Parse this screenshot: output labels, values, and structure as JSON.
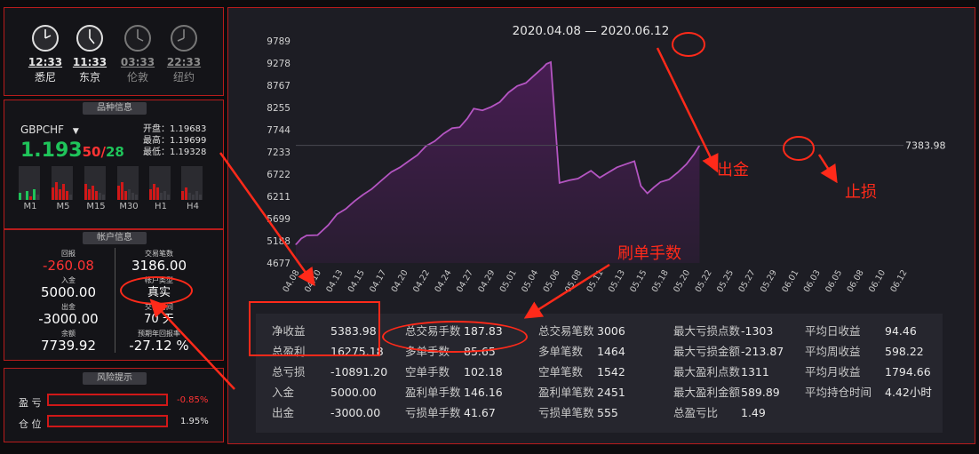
{
  "clocks": [
    {
      "time": "12:33",
      "city": "悉尼",
      "active": true
    },
    {
      "time": "11:33",
      "city": "东京",
      "active": true
    },
    {
      "time": "03:33",
      "city": "伦敦",
      "active": false
    },
    {
      "time": "22:33",
      "city": "纽约",
      "active": false
    }
  ],
  "symbol": {
    "section_title": "品种信息",
    "name": "GBPCHF",
    "price_main": "1.193",
    "price_frac": "50",
    "price_sep": "/",
    "spread": "28",
    "open": "开盘：1.19683",
    "high": "最高：1.19699",
    "low": "最低：1.19328",
    "timeframes": [
      "M1",
      "M5",
      "M15",
      "M30",
      "H1",
      "H4"
    ]
  },
  "account": {
    "section_title": "帐户信息",
    "drawdown_label": "回报",
    "drawdown_value": "-260.08",
    "trades_label": "交易笔数",
    "trades_value": "3186.00",
    "deposit_label": "入金",
    "deposit_value": "5000.00",
    "type_label": "帐户类型",
    "type_value": "真实",
    "withdraw_label": "出金",
    "withdraw_value": "-3000.00",
    "days_label": "交易时间",
    "days_value": "70 天",
    "balance_label": "余额",
    "balance_value": "7739.92",
    "annual_label": "预期年回报率",
    "annual_value": "-27.12 %"
  },
  "risk": {
    "section_title": "风险提示",
    "profit_label": "盈 亏",
    "profit_value": "-0.85%",
    "position_label": "仓 位",
    "position_value": "1.95%"
  },
  "chart_data": {
    "type": "area",
    "title": "2020.04.08 — 2020.06.12",
    "last_value_label": "7383.98",
    "ylim": [
      4677,
      9789
    ],
    "yticks": [
      4677,
      5188,
      5699,
      6211,
      6722,
      7233,
      7744,
      8255,
      8767,
      9278,
      9789
    ],
    "xticks": [
      "04.08",
      "04.10",
      "04.13",
      "04.15",
      "04.17",
      "04.20",
      "04.22",
      "04.24",
      "04.27",
      "04.29",
      "05.01",
      "05.04",
      "05.06",
      "05.08",
      "05.11",
      "05.13",
      "05.15",
      "05.18",
      "05.20",
      "05.22",
      "05.25",
      "05.27",
      "05.29",
      "06.01",
      "06.03",
      "06.05",
      "06.08",
      "06.10",
      "06.12"
    ],
    "points": [
      [
        0,
        5100
      ],
      [
        0.25,
        5240
      ],
      [
        0.5,
        5310
      ],
      [
        1.0,
        5320
      ],
      [
        1.5,
        5550
      ],
      [
        1.9,
        5800
      ],
      [
        2.3,
        5920
      ],
      [
        2.7,
        6100
      ],
      [
        3.1,
        6250
      ],
      [
        3.5,
        6380
      ],
      [
        4.0,
        6600
      ],
      [
        4.4,
        6770
      ],
      [
        4.8,
        6880
      ],
      [
        5.2,
        7020
      ],
      [
        5.6,
        7160
      ],
      [
        6.0,
        7370
      ],
      [
        6.4,
        7480
      ],
      [
        6.8,
        7650
      ],
      [
        7.2,
        7780
      ],
      [
        7.55,
        7800
      ],
      [
        7.9,
        8000
      ],
      [
        8.2,
        8230
      ],
      [
        8.6,
        8190
      ],
      [
        9.0,
        8270
      ],
      [
        9.4,
        8380
      ],
      [
        9.8,
        8600
      ],
      [
        10.2,
        8750
      ],
      [
        10.6,
        8820
      ],
      [
        11.0,
        9000
      ],
      [
        11.4,
        9180
      ],
      [
        11.55,
        9260
      ],
      [
        11.75,
        9300
      ],
      [
        12.15,
        6520
      ],
      [
        12.6,
        6580
      ],
      [
        13.0,
        6620
      ],
      [
        13.3,
        6710
      ],
      [
        13.6,
        6800
      ],
      [
        14.0,
        6640
      ],
      [
        14.4,
        6760
      ],
      [
        14.8,
        6880
      ],
      [
        15.2,
        6950
      ],
      [
        15.6,
        7020
      ],
      [
        15.9,
        6450
      ],
      [
        16.2,
        6280
      ],
      [
        16.5,
        6420
      ],
      [
        16.8,
        6540
      ],
      [
        17.2,
        6600
      ],
      [
        17.6,
        6760
      ],
      [
        18.0,
        6950
      ],
      [
        18.35,
        7180
      ],
      [
        18.6,
        7383.98
      ]
    ],
    "line_color": "#b455c2",
    "fill_color": "#4a1d55"
  },
  "stats": {
    "col1": [
      {
        "label": "净收益",
        "value": "5383.98"
      },
      {
        "label": "总盈利",
        "value": "16275.18"
      },
      {
        "label": "总亏损",
        "value": "-10891.20"
      },
      {
        "label": "入金",
        "value": "5000.00"
      },
      {
        "label": "出金",
        "value": "-3000.00"
      }
    ],
    "col2": [
      {
        "label": "总交易手数",
        "value": "187.83"
      },
      {
        "label": "多单手数",
        "value": "85.65"
      },
      {
        "label": "空单手数",
        "value": "102.18"
      },
      {
        "label": "盈利单手数",
        "value": "146.16"
      },
      {
        "label": "亏损单手数",
        "value": "41.67"
      }
    ],
    "col3": [
      {
        "label": "总交易笔数",
        "value": "3006"
      },
      {
        "label": "多单笔数",
        "value": "1464"
      },
      {
        "label": "空单笔数",
        "value": "1542"
      },
      {
        "label": "盈利单笔数",
        "value": "2451"
      },
      {
        "label": "亏损单笔数",
        "value": "555"
      }
    ],
    "col4": [
      {
        "label": "最大亏损点数",
        "value": "-1303"
      },
      {
        "label": "最大亏损金额",
        "value": "-213.87"
      },
      {
        "label": "最大盈利点数",
        "value": "1311"
      },
      {
        "label": "最大盈利金额",
        "value": "589.89"
      },
      {
        "label": "总盈亏比",
        "value": "1.49"
      }
    ],
    "col5": [
      {
        "label": "平均日收益",
        "value": "94.46"
      },
      {
        "label": "平均周收益",
        "value": "598.22"
      },
      {
        "label": "平均月收益",
        "value": "1794.66"
      },
      {
        "label": "平均持仓时间",
        "value": "4.42小时"
      }
    ]
  },
  "annotations": {
    "withdraw": "出金",
    "stop_loss": "止损",
    "volume": "刷单手数"
  },
  "colors": {
    "border": "#b81c1c",
    "green": "#1fc45a",
    "red": "#ff3333",
    "annot": "#ff2a1a"
  }
}
